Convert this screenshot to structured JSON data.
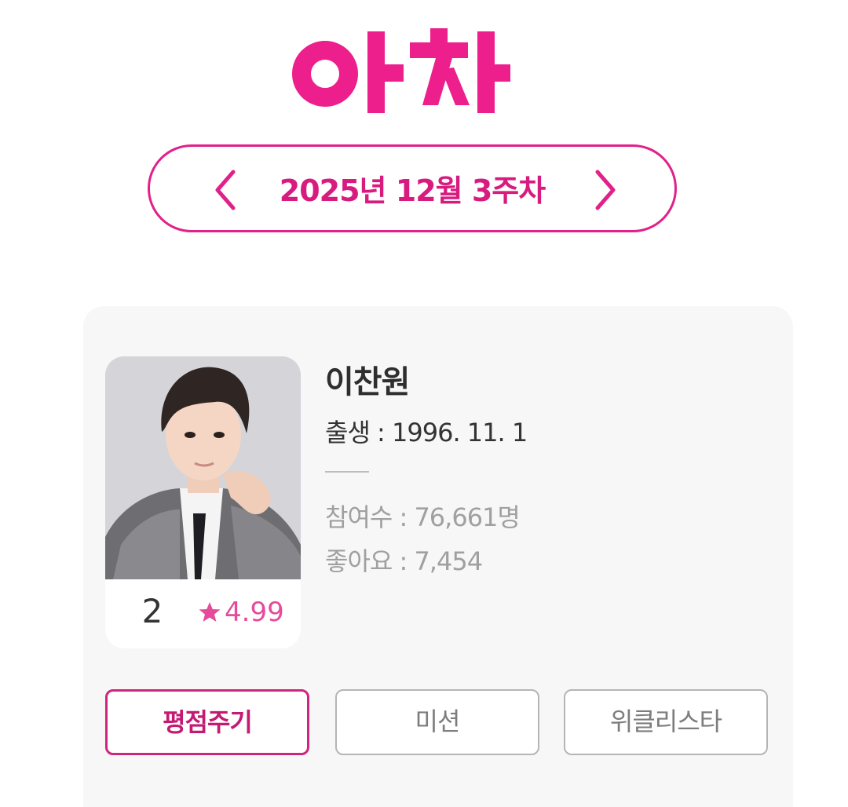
{
  "app": {
    "logo_text": "아차",
    "brand_color": "#ec1f8c"
  },
  "week_selector": {
    "label": "2025년 12월 3주차",
    "prev_icon": "chevron-left-icon",
    "next_icon": "chevron-right-icon"
  },
  "profile": {
    "name": "이찬원",
    "birth": "출생 : 1996. 11. 1",
    "participants": "참여수 : 76,661명",
    "likes": "좋아요 : 7,454",
    "rank": "2",
    "rating": "4.99",
    "rating_icon": "star-icon"
  },
  "actions": {
    "rate_label": "평점주기",
    "mission_label": "미션",
    "weekly_star_label": "위클리스타"
  },
  "colors": {
    "accent": "#d81b7f",
    "rating": "#e64a9a",
    "card_bg": "#f7f7f8",
    "muted_text": "#a0a0a0"
  }
}
